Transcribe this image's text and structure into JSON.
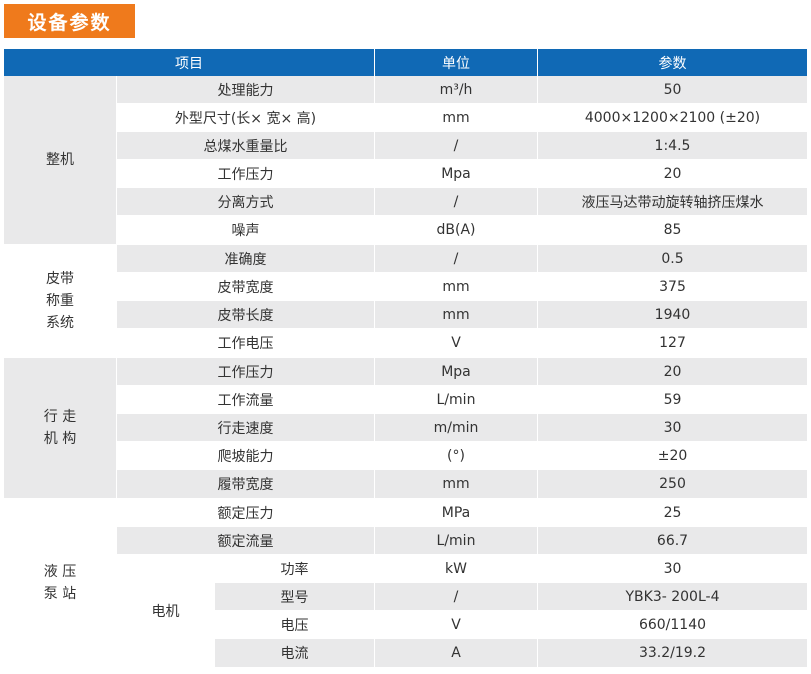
{
  "title": "设备参数",
  "header": {
    "item": "项目",
    "unit": "单位",
    "param": "参数"
  },
  "groups": [
    {
      "label": "整机",
      "rows": [
        {
          "item": "处理能力",
          "unit": "m³/h",
          "param": "50"
        },
        {
          "item": "外型尺寸(长× 宽× 高)",
          "unit": "mm",
          "param": "4000×1200×2100 (±20)"
        },
        {
          "item": "总煤水重量比",
          "unit": "/",
          "param": "1:4.5"
        },
        {
          "item": "工作压力",
          "unit": "Mpa",
          "param": "20"
        },
        {
          "item": "分离方式",
          "unit": "/",
          "param": "液压马达带动旋转轴挤压煤水"
        },
        {
          "item": "噪声",
          "unit": "dB(A)",
          "param": "85"
        }
      ]
    },
    {
      "label": "皮带\n称重\n系统",
      "rows": [
        {
          "item": "准确度",
          "unit": "/",
          "param": "0.5"
        },
        {
          "item": "皮带宽度",
          "unit": "mm",
          "param": "375"
        },
        {
          "item": "皮带长度",
          "unit": "mm",
          "param": "1940"
        },
        {
          "item": "工作电压",
          "unit": "V",
          "param": "127"
        }
      ]
    },
    {
      "label": "行 走\n机 构",
      "rows": [
        {
          "item": "工作压力",
          "unit": "Mpa",
          "param": "20"
        },
        {
          "item": "工作流量",
          "unit": "L/min",
          "param": "59"
        },
        {
          "item": "行走速度",
          "unit": "m/min",
          "param": "30"
        },
        {
          "item": "爬坡能力",
          "unit": "(°)",
          "param": "±20"
        },
        {
          "item": "履带宽度",
          "unit": "mm",
          "param": "250"
        }
      ]
    },
    {
      "label": "液 压\n泵 站",
      "rows": [
        {
          "item": "额定压力",
          "unit": "MPa",
          "param": "25"
        },
        {
          "item": "额定流量",
          "unit": "L/min",
          "param": "66.7"
        }
      ],
      "sub": {
        "label": "电机",
        "rows": [
          {
            "item": "功率",
            "unit": "kW",
            "param": "30"
          },
          {
            "item": "型号",
            "unit": "/",
            "param": "YBK3- 200L-4"
          },
          {
            "item": "电压",
            "unit": "V",
            "param": "660/1140"
          },
          {
            "item": "电流",
            "unit": "A",
            "param": "33.2/19.2"
          }
        ]
      }
    }
  ]
}
